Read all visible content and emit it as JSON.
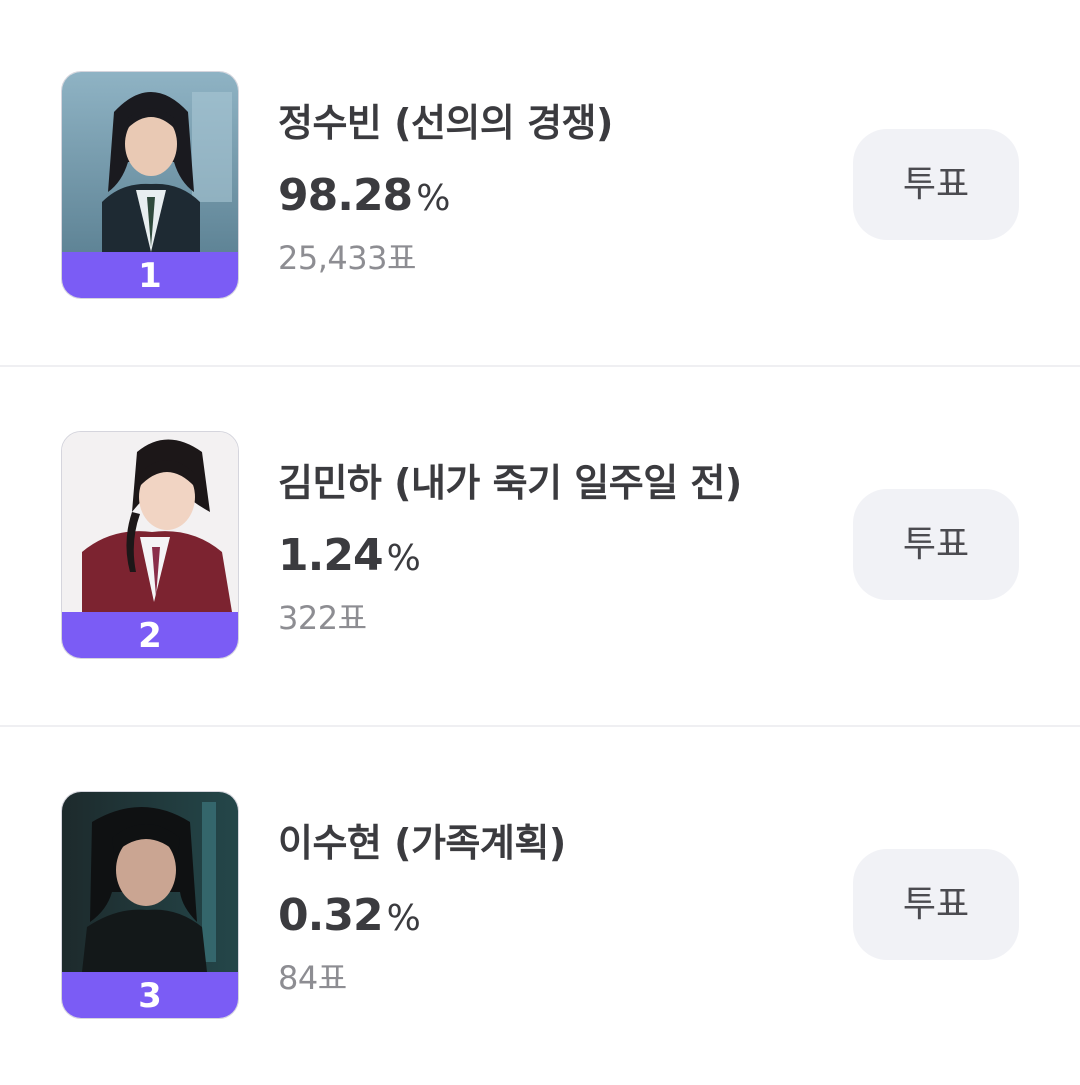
{
  "candidates": [
    {
      "rank": "1",
      "name": "정수빈 (선의의 경쟁)",
      "percent": "98.28",
      "percent_sign": "%",
      "votes": "25,433표",
      "vote_button_label": "투표",
      "percent_value": 98.28
    },
    {
      "rank": "2",
      "name": "김민하 (내가 죽기 일주일 전)",
      "percent": "1.24",
      "percent_sign": "%",
      "votes": "322표",
      "vote_button_label": "투표",
      "percent_value": 1.24
    },
    {
      "rank": "3",
      "name": "이수현 (가족계획)",
      "percent": "0.32",
      "percent_sign": "%",
      "votes": "84표",
      "vote_button_label": "투표",
      "percent_value": 0.32
    }
  ],
  "colors": {
    "rank_band": "#7b5cf5",
    "vote_button_bg": "#f1f2f6",
    "name_text": "#3b3b3f",
    "votes_text": "#8d8d92",
    "divider": "#efeff2"
  }
}
